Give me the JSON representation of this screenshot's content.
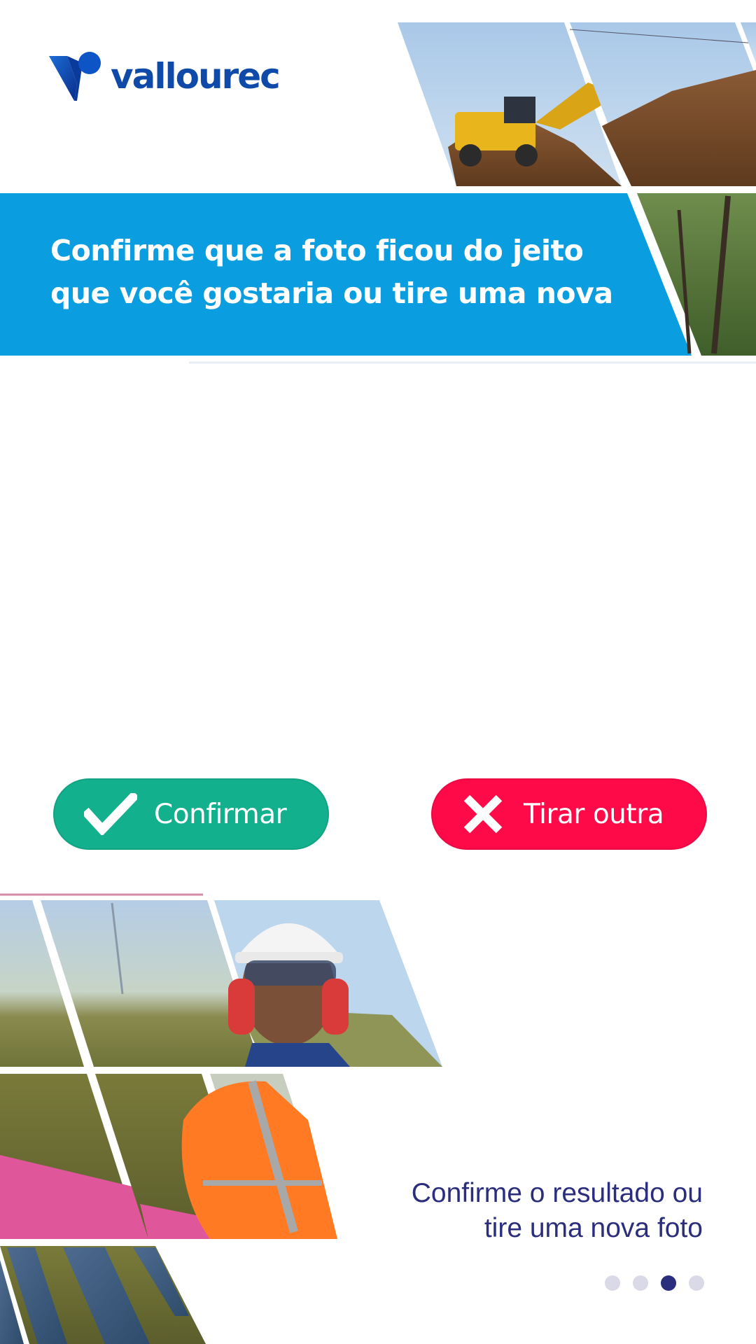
{
  "brand": {
    "name": "vallourec",
    "logo_color": "#0f4aa8"
  },
  "banner": {
    "line1": "Confirme que a foto ficou do jeito",
    "line2": "que você gostaria ou tire uma nova",
    "background": "#0a9ddf"
  },
  "actions": {
    "confirm": {
      "label": "Confirmar",
      "icon": "checkmark-icon",
      "color": "#13b08e"
    },
    "retake": {
      "label": "Tirar outra",
      "icon": "close-x-icon",
      "color": "#ff0a49"
    }
  },
  "footer": {
    "line1": "Confirme o resultado ou",
    "line2": "tire uma nova foto",
    "color": "#2b2e7d"
  },
  "pagination": {
    "total": 4,
    "current": 3
  },
  "photos": [
    "wheel-loader-photo",
    "dirt-pile-photo",
    "trees-photo",
    "sky-tower-photo",
    "worker-helmet-photo",
    "field-photo",
    "pink-sign-photo",
    "orange-jacket-worker-photo",
    "solar-panels-photo"
  ]
}
